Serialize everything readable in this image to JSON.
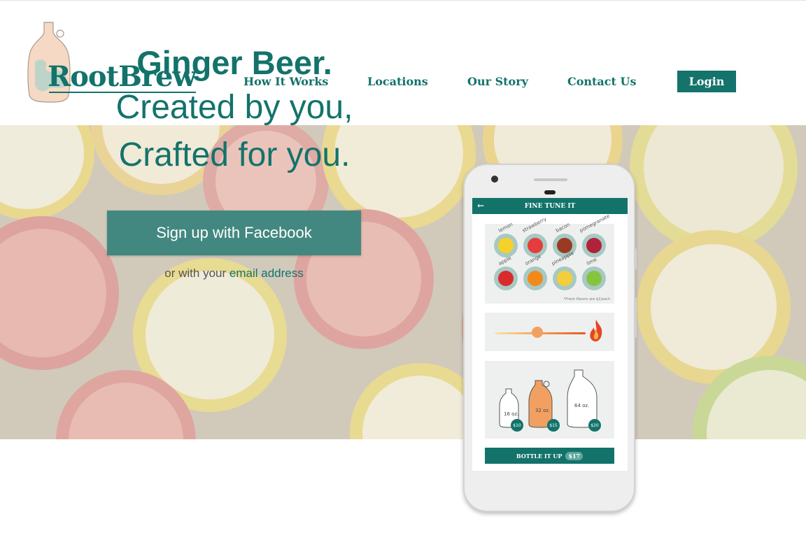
{
  "brand": {
    "name": "RootBrew",
    "accent": "#13736b",
    "logo_bg": "#f6d9c4"
  },
  "nav": {
    "items": [
      {
        "label": "How It Works"
      },
      {
        "label": "Locations"
      },
      {
        "label": "Our Story"
      },
      {
        "label": "Contact Us"
      }
    ],
    "login_label": "Login"
  },
  "hero": {
    "line1": "Ginger Beer.",
    "line2": "Created by you,",
    "line3": "Crafted for you.",
    "facebook_button": "Sign up with Facebook",
    "email_prefix": "or with your",
    "email_link": "email address"
  },
  "app": {
    "title": "FINE TUNE IT",
    "flavors": [
      {
        "label": "lemon",
        "color": "#f6d12a"
      },
      {
        "label": "strawberry",
        "color": "#e53d3d"
      },
      {
        "label": "bacon",
        "color": "#9b3a22"
      },
      {
        "label": "pomegranate",
        "color": "#b0233b"
      },
      {
        "label": "apple",
        "color": "#d92b2b"
      },
      {
        "label": "orange",
        "color": "#f28a1b"
      },
      {
        "label": "pineapple",
        "color": "#f2cf3a"
      },
      {
        "label": "lime",
        "color": "#86c440"
      }
    ],
    "flavor_note": "*Fresh flavors are $1/each",
    "heat_level": 0.47,
    "sizes": [
      {
        "label": "16 oz.",
        "price": "$10"
      },
      {
        "label": "32 oz.",
        "price": "$15"
      },
      {
        "label": "64 oz.",
        "price": "$20"
      }
    ],
    "bottle_button": "BOTTLE IT UP",
    "bottle_price": "$17"
  }
}
